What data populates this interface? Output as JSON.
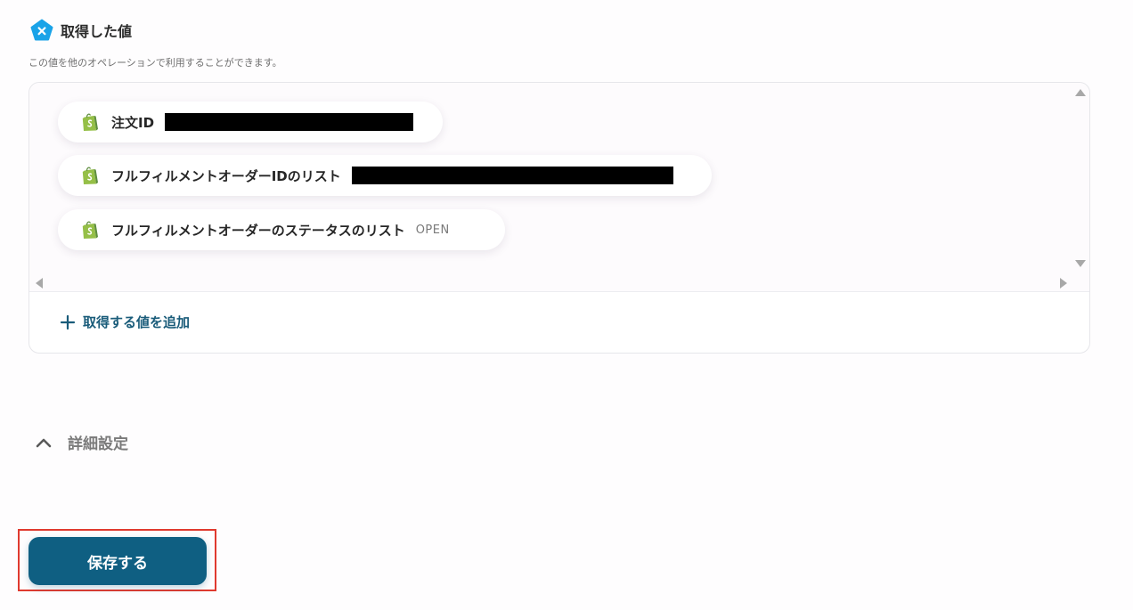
{
  "section": {
    "title": "取得した値",
    "description": "この値を他のオペレーションで利用することができます。",
    "logo_icon": "x-badge-icon",
    "accent_color": "#1aa3e8"
  },
  "values": {
    "items": [
      {
        "label": "注文ID",
        "value": "",
        "redacted": true,
        "icon": "shopify-icon"
      },
      {
        "label": "フルフィルメントオーダーIDのリスト",
        "value": "",
        "redacted": true,
        "icon": "shopify-icon"
      },
      {
        "label": "フルフィルメントオーダーのステータスのリスト",
        "value": "OPEN",
        "redacted": false,
        "icon": "shopify-icon"
      }
    ],
    "add_label": "取得する値を追加"
  },
  "details": {
    "label": "詳細設定",
    "expanded": true
  },
  "footer": {
    "save_label": "保存する",
    "primary_color": "#0f5f82",
    "highlight_color": "#e03a2f"
  }
}
